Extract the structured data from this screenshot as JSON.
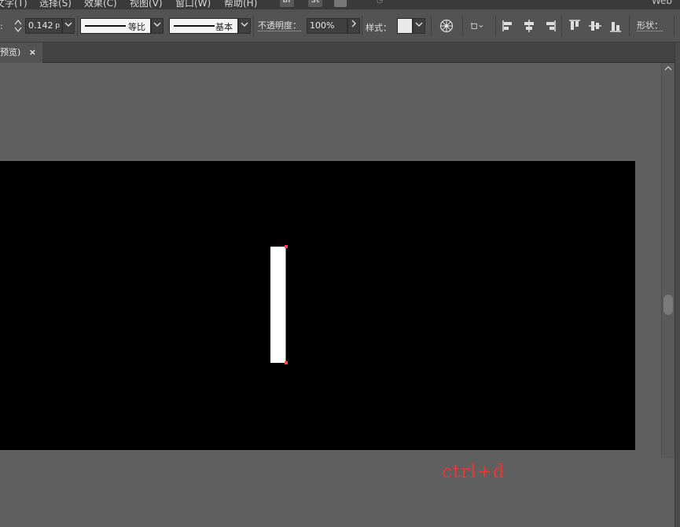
{
  "menubar": {
    "items": [
      "文字(T)",
      "选择(S)",
      "效果(C)",
      "视图(V)",
      "窗口(W)",
      "帮助(H)"
    ],
    "apps": [
      "Br",
      "St"
    ],
    "workspace": "Web"
  },
  "controlbar": {
    "stroke_weight_value": "0.142",
    "stroke_weight_unit": "p",
    "stroke_profile_label": "等比",
    "brush_label": "基本",
    "opacity_label": "不透明度：",
    "opacity_value": "100%",
    "style_label": "样式：",
    "shape_label": "形状："
  },
  "tabs": [
    {
      "label": "预览)",
      "close": "×"
    }
  ],
  "canvas": {
    "annotation": "ctrl+d",
    "annotation_color": "#e23a3a",
    "artboard_color": "#000000",
    "shape_fill": "#ffffff",
    "selection_color": "#ff4a4a"
  },
  "icons": [
    "spinner-icon",
    "chevron-down-icon",
    "chevron-right-icon",
    "recolor-icon",
    "transform-icon",
    "align-left-icon",
    "align-center-icon",
    "align-right-icon",
    "align-top-icon",
    "align-middle-icon",
    "align-bottom-icon",
    "close-icon"
  ]
}
